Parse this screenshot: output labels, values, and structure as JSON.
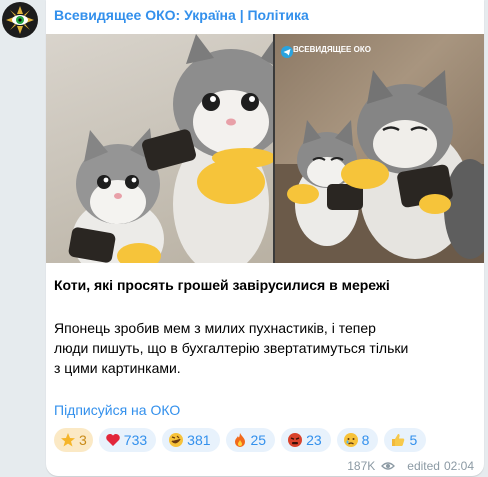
{
  "post": {
    "channel_title": "Всевидящее ОКО: Україна | Політика",
    "media_watermark": "ВСЕВИДЯЩЕЕ ОКО",
    "title": "Коти, які просять грошей завірусилися в мережі",
    "body": "Японець зробив мем з милих пухнастиків, і тепер люди пишуть, що в бухгалтерію звертатимуться тільки з цими картинками.",
    "link": "Підписуйся на ОКО"
  },
  "reactions": [
    {
      "icon": "star-icon",
      "count": "3"
    },
    {
      "icon": "red-heart-icon",
      "count": "733"
    },
    {
      "icon": "rofl-face-icon",
      "count": "381"
    },
    {
      "icon": "fire-icon",
      "count": "25"
    },
    {
      "icon": "angry-face-icon",
      "count": "23"
    },
    {
      "icon": "crying-face-icon",
      "count": "8"
    },
    {
      "icon": "thumbs-up-icon",
      "count": "5"
    }
  ],
  "footer": {
    "views": "187K",
    "edited": "edited",
    "time": "02:04"
  },
  "colors": {
    "accent": "#3390ec",
    "background": "#e6ebee",
    "reaction_bg": "#e8f2fc",
    "star_bg": "#fbe9c5"
  }
}
